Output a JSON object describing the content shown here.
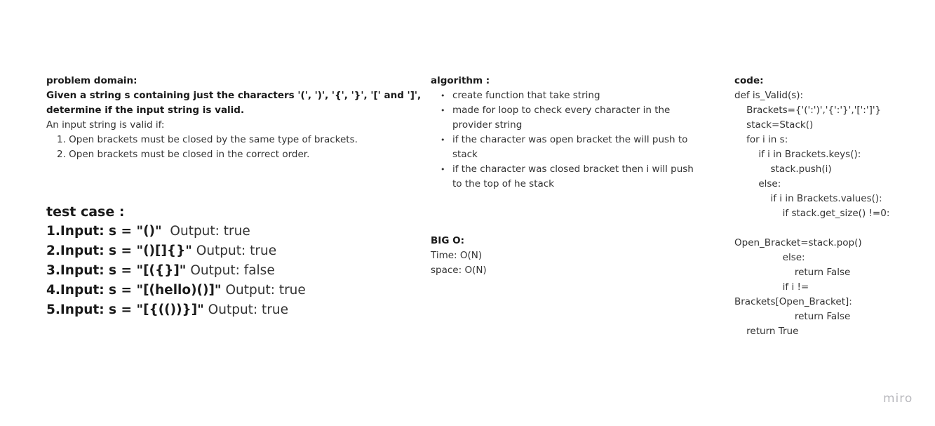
{
  "problem": {
    "heading": "problem domain:",
    "desc_line1": "Given a string s containing just the characters '(', ')', '{', '}', '[' and ']',",
    "desc_line2": "determine if the input string is valid.",
    "intro": "An input string is valid if:",
    "rules": [
      "1. Open brackets must be closed by the same type of brackets.",
      "2. Open brackets must be closed in the correct order."
    ]
  },
  "tests": {
    "heading": "test case :",
    "cases": [
      {
        "input": "1.Input: s = \"()\"",
        "output": "  Output: true"
      },
      {
        "input": "2.Input: s = \"()[]{}\"",
        "output": " Output: true"
      },
      {
        "input": "3.Input: s = \"[({}]\"",
        "output": " Output: false"
      },
      {
        "input": "4.Input: s = \"[(hello)()]\"",
        "output": " Output: true"
      },
      {
        "input": "5.Input: s = \"[{(())}]\"",
        "output": " Output: true"
      }
    ]
  },
  "algorithm": {
    "heading": "algorithm :",
    "bullet": "•",
    "steps": [
      "create function that take string",
      "made for loop to check every character in  the provider string",
      "if the character was open bracket the will push to stack",
      "if the character was closed bracket then i will push to the top of he stack"
    ]
  },
  "bigo": {
    "heading": "BIG O:",
    "time": "Time: O(N)",
    "space": "space: O(N)"
  },
  "code": {
    "heading": "code:",
    "lines": [
      "def is_Valid(s):",
      "    Brackets={'(':')','{':'}','[':']'}",
      "    stack=Stack()",
      "    for i in s:",
      "        if i in Brackets.keys():",
      "            stack.push(i)",
      "        else:",
      "            if i in Brackets.values():",
      "                if stack.get_size() !=0:",
      "",
      "Open_Bracket=stack.pop()",
      "                else:",
      "                    return False",
      "                if i !=",
      "Brackets[Open_Bracket]:",
      "                    return False",
      "    return True"
    ]
  },
  "logo": "miro"
}
